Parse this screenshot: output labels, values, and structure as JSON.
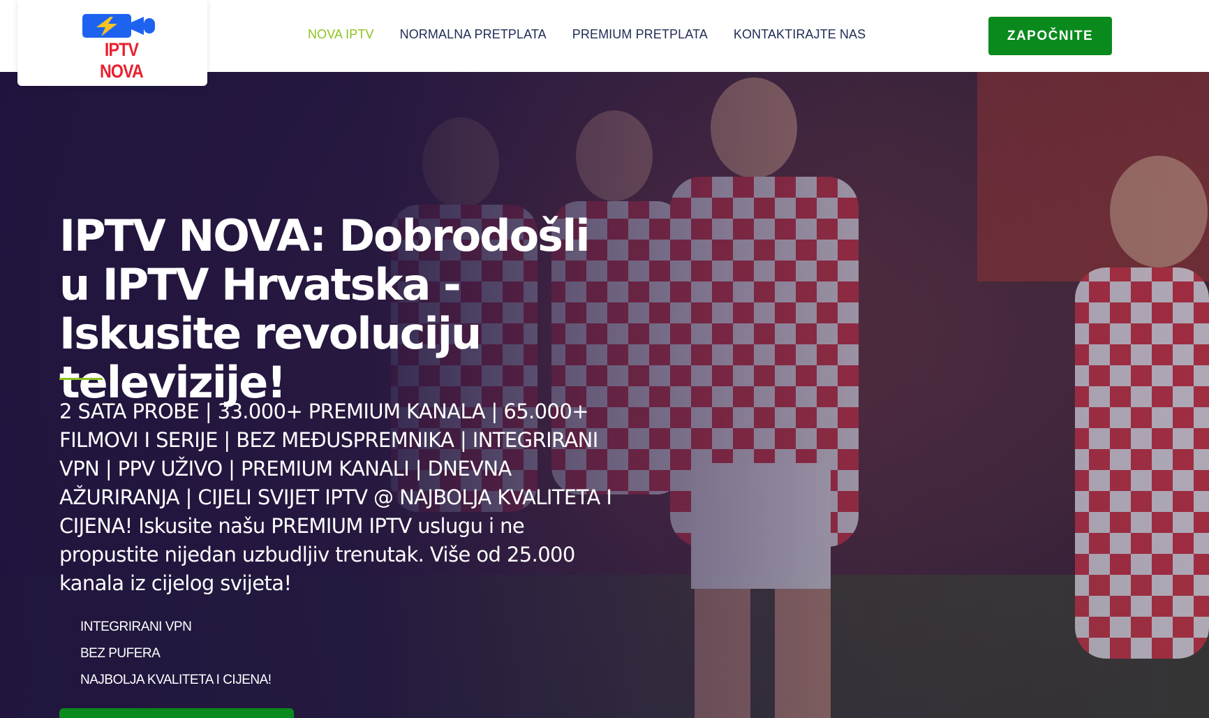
{
  "header": {
    "logo": {
      "text": "IPTV NOVA",
      "icon": "lightning-camera-icon",
      "brand_color": "#e8212d",
      "icon_color": "#1e63f0",
      "bolt_color": "#f7c325"
    },
    "nav": [
      {
        "label": "NOVA IPTV",
        "active": true
      },
      {
        "label": "NORMALNA PRETPLATA",
        "active": false
      },
      {
        "label": "PREMIUM PRETPLATA",
        "active": false
      },
      {
        "label": "KONTAKTIRAJTE NAS",
        "active": false
      }
    ],
    "cta_label": "ZAPOČNITE"
  },
  "hero": {
    "title": "IPTV NOVA: Dobrodošli u IPTV Hrvatska - Iskusite revoluciju televizije!",
    "text": "2 SATA PROBE | 33.000+ PREMIUM KANALA | 65.000+ FILMOVI I SERIJE | BEZ MEĐUSPREMNIKA | INTEGRIRANI VPN | PPV UŽIVO | PREMIUM KANALI | DNEVNA AŽURIRANJA | CIJELI SVIJET IPTV @ NAJBOLJA KVALITETA I CIJENA! Iskusite našu PREMIUM IPTV uslugu i ne propustite nijedan uzbudljiv trenutak. Više od 25.000 kanala iz cijelog svijeta!",
    "features": [
      "INTEGRIRANI VPN",
      "BEZ PUFERA",
      "NAJBOLJA KVALITETA I CIJENA!"
    ],
    "background": "football-players-croatia-photo"
  },
  "colors": {
    "accent_green": "#8cc21e",
    "button_green": "#0a8a1d",
    "nav_text": "#1e2a55",
    "hero_overlay": "#20143e"
  }
}
